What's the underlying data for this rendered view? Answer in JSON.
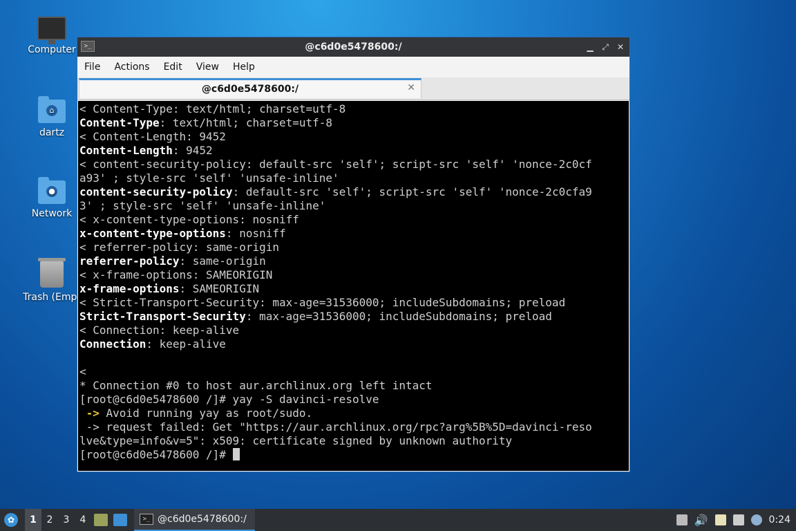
{
  "desktop": {
    "icons": [
      {
        "label": "Computer",
        "icon": "computer-icon"
      },
      {
        "label": "dartz",
        "icon": "home-folder-icon"
      },
      {
        "label": "Network",
        "icon": "network-folder-icon"
      },
      {
        "label": "Trash (Empt",
        "icon": "trash-icon"
      }
    ]
  },
  "window": {
    "title": "@c6d0e5478600:/",
    "controls": {
      "minimize": "▁",
      "maximize": "⤢",
      "close": "✕"
    },
    "menu": [
      "File",
      "Actions",
      "Edit",
      "View",
      "Help"
    ],
    "tab": {
      "title": "@c6d0e5478600:/",
      "close": "✕"
    }
  },
  "terminal": {
    "lines": [
      {
        "bold": "",
        "text": "< Content-Type: text/html; charset=utf-8"
      },
      {
        "bold": "Content-Type",
        "text": ": text/html; charset=utf-8"
      },
      {
        "bold": "",
        "text": "< Content-Length: 9452"
      },
      {
        "bold": "Content-Length",
        "text": ": 9452"
      },
      {
        "bold": "",
        "text": "< content-security-policy: default-src 'self'; script-src 'self' 'nonce-2c0cf"
      },
      {
        "bold": "",
        "text": "a93' ; style-src 'self' 'unsafe-inline'"
      },
      {
        "bold": "content-security-policy",
        "text": ": default-src 'self'; script-src 'self' 'nonce-2c0cfa9"
      },
      {
        "bold": "",
        "text": "3' ; style-src 'self' 'unsafe-inline'"
      },
      {
        "bold": "",
        "text": "< x-content-type-options: nosniff"
      },
      {
        "bold": "x-content-type-options",
        "text": ": nosniff"
      },
      {
        "bold": "",
        "text": "< referrer-policy: same-origin"
      },
      {
        "bold": "referrer-policy",
        "text": ": same-origin"
      },
      {
        "bold": "",
        "text": "< x-frame-options: SAMEORIGIN"
      },
      {
        "bold": "x-frame-options",
        "text": ": SAMEORIGIN"
      },
      {
        "bold": "",
        "text": "< Strict-Transport-Security: max-age=31536000; includeSubdomains; preload"
      },
      {
        "bold": "Strict-Transport-Security",
        "text": ": max-age=31536000; includeSubdomains; preload"
      },
      {
        "bold": "",
        "text": "< Connection: keep-alive"
      },
      {
        "bold": "Connection",
        "text": ": keep-alive"
      },
      {
        "bold": "",
        "text": ""
      },
      {
        "bold": "",
        "text": "<"
      },
      {
        "bold": "",
        "text": "* Connection #0 to host aur.archlinux.org left intact"
      },
      {
        "bold": "",
        "text": "[root@c6d0e5478600 /]# yay -S davinci-resolve"
      },
      {
        "arrow": " ->",
        "text": " Avoid running yay as root/sudo."
      },
      {
        "bold": "",
        "text": " -> request failed: Get \"https://aur.archlinux.org/rpc?arg%5B%5D=davinci-reso"
      },
      {
        "bold": "",
        "text": "lve&type=info&v=5\": x509: certificate signed by unknown authority"
      },
      {
        "bold": "",
        "text": "[root@c6d0e5478600 /]# ",
        "cursor": true
      }
    ]
  },
  "taskbar": {
    "workspaces": [
      "1",
      "2",
      "3",
      "4"
    ],
    "active_workspace": "1",
    "task_label": "@c6d0e5478600:/",
    "clock": "0:24"
  }
}
